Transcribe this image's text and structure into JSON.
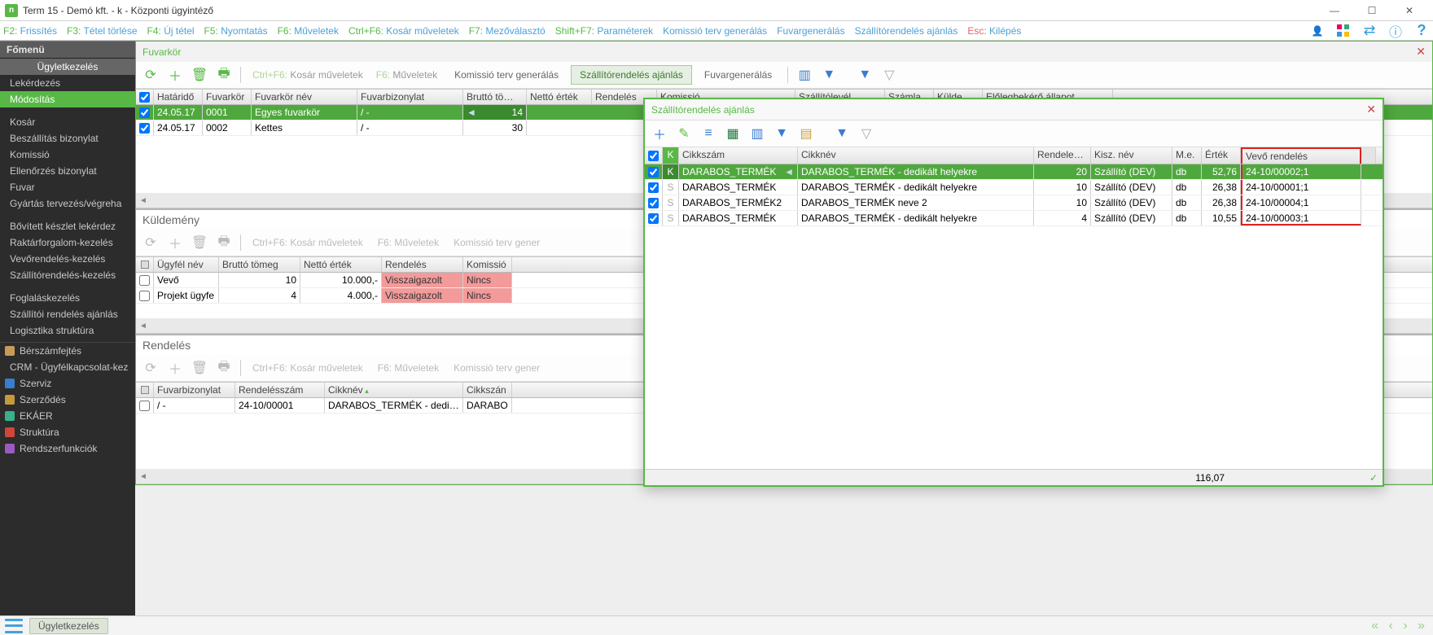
{
  "window": {
    "title": "Term 15 - Demó kft. - k - Központi ügyintéző"
  },
  "menubar": {
    "items": [
      {
        "key": "F2:",
        "label": "Frissítés"
      },
      {
        "key": "F3:",
        "label": "Tétel törlése"
      },
      {
        "key": "F4:",
        "label": "Új tétel"
      },
      {
        "key": "F5:",
        "label": "Nyomtatás"
      },
      {
        "key": "F6:",
        "label": "Műveletek"
      },
      {
        "key": "Ctrl+F6:",
        "label": "Kosár műveletek"
      },
      {
        "key": "F7:",
        "label": "Mezőválasztó"
      },
      {
        "key": "Shift+F7:",
        "label": "Paraméterek"
      },
      {
        "key": "",
        "label": "Komissió terv generálás"
      },
      {
        "key": "",
        "label": "Fuvargenerálás"
      },
      {
        "key": "",
        "label": "Szállítórendelés ajánlás"
      },
      {
        "key": "Esc:",
        "label": "Kilépés",
        "esc": true
      }
    ]
  },
  "sidebar": {
    "section": "Főmenü",
    "group": "Ügyletkezelés",
    "items_top": [
      {
        "label": "Lekérdezés"
      },
      {
        "label": "Módosítás",
        "active": true
      }
    ],
    "items_mid": [
      "Kosár",
      "Beszállítás bizonylat",
      "Komissió",
      "Ellenőrzés bizonylat",
      "Fuvar",
      "Gyártás tervezés/végreha"
    ],
    "items_low": [
      "Bővített készlet lekérdez",
      "Raktárforgalom-kezelés",
      "Vevőrendelés-kezelés",
      "Szállítórendelés-kezelés"
    ],
    "items_bottom": [
      "Foglaláskezelés",
      "Szállítói rendelés ajánlás",
      "Logisztika struktúra"
    ],
    "modules": [
      {
        "label": "Bérszámfejtés",
        "color": "#c89a5a"
      },
      {
        "label": "CRM - Ügyfélkapcsolat-kez",
        "color": "#c44"
      },
      {
        "label": "Szerviz",
        "color": "#3a7cd0"
      },
      {
        "label": "Szerződés",
        "color": "#c49a3a"
      },
      {
        "label": "EKÁER",
        "color": "#3ab08a"
      },
      {
        "label": "Struktúra",
        "color": "#d0473a"
      },
      {
        "label": "Rendszerfunkciók",
        "color": "#9a5ac0"
      }
    ]
  },
  "fuvarkor": {
    "title": "Fuvarkör",
    "toolbar_text": [
      {
        "key": "Ctrl+F6:",
        "label": "Kosár műveletek"
      },
      {
        "key": "F6:",
        "label": "Műveletek"
      },
      {
        "key": "",
        "label": "Komissió terv generálás"
      },
      {
        "key": "",
        "label": "Szállítórendelés ajánlás",
        "active": true
      },
      {
        "key": "",
        "label": "Fuvargenerálás"
      }
    ],
    "columns": [
      "Határidő",
      "Fuvarkör",
      "Fuvarkör név",
      "Fuvarbizonylat",
      "Bruttó tö…",
      "Nettó érték",
      "Rendelés",
      "Komissió",
      "Szállítólevél",
      "Számla",
      "Külde…",
      "Előlegbekérő állapot"
    ],
    "rows": [
      {
        "chk": true,
        "vals": [
          "24.05.17",
          "0001",
          "Egyes fuvarkör",
          "/  -",
          "14"
        ],
        "selected": true
      },
      {
        "chk": true,
        "vals": [
          "24.05.17",
          "0002",
          "Kettes",
          "/  -",
          "30"
        ],
        "selected": false
      }
    ]
  },
  "kuldemeny": {
    "title": "Küldemény",
    "toolbar_text": [
      {
        "key": "Ctrl+F6:",
        "label": "Kosár műveletek"
      },
      {
        "key": "F6:",
        "label": "Műveletek"
      },
      {
        "key": "",
        "label": "Komissió terv gener"
      }
    ],
    "columns": [
      "Ügyfél név",
      "Bruttó tömeg",
      "Nettó érték",
      "Rendelés",
      "Komissió"
    ],
    "rows": [
      {
        "vals": [
          "Vevő",
          "10",
          "10.000,-",
          "Visszaigazolt",
          "Nincs"
        ]
      },
      {
        "vals": [
          "Projekt  ügyfe",
          "4",
          "4.000,-",
          "Visszaigazolt",
          "Nincs"
        ]
      }
    ]
  },
  "rendeles": {
    "title": "Rendelés",
    "toolbar_text": [
      {
        "key": "Ctrl+F6:",
        "label": "Kosár műveletek"
      },
      {
        "key": "F6:",
        "label": "Műveletek"
      },
      {
        "key": "",
        "label": "Komissió terv gener"
      }
    ],
    "columns": [
      "Fuvarbizonylat",
      "Rendelésszám",
      "Cikknév",
      "Cikkszán"
    ],
    "rows": [
      {
        "vals": [
          "/  -",
          "24-10/00001",
          "DARABOS_TERMÉK - dedikált",
          "DARABO"
        ]
      }
    ]
  },
  "popup": {
    "title": "Szállítórendelés ajánlás",
    "columns": [
      "K",
      "Cikkszám",
      "Cikknév",
      "Rendelendő",
      "Kisz. név",
      "M.e.",
      "Érték",
      "Vevő rendelés"
    ],
    "rows": [
      {
        "chk": true,
        "selected": true,
        "k": "K",
        "vals": [
          "DARABOS_TERMÉK",
          "DARABOS_TERMÉK - dedikált helyekre",
          "20",
          "Szállító (DEV)",
          "db",
          "52,76",
          "24-10/00002;1"
        ]
      },
      {
        "chk": true,
        "selected": false,
        "k": "S",
        "vals": [
          "DARABOS_TERMÉK",
          "DARABOS_TERMÉK - dedikált helyekre",
          "10",
          "Szállító (DEV)",
          "db",
          "26,38",
          "24-10/00001;1"
        ]
      },
      {
        "chk": true,
        "selected": false,
        "k": "S",
        "vals": [
          "DARABOS_TERMÉK2",
          "DARABOS_TERMÉK neve 2",
          "10",
          "Szállító (DEV)",
          "db",
          "26,38",
          "24-10/00004;1"
        ]
      },
      {
        "chk": true,
        "selected": false,
        "k": "S",
        "vals": [
          "DARABOS_TERMÉK",
          "DARABOS_TERMÉK - dedikált helyekre",
          "4",
          "Szállító (DEV)",
          "db",
          "10,55",
          "24-10/00003;1"
        ]
      }
    ],
    "footer_total": "116,07"
  },
  "status": {
    "label": "Ügyletkezelés"
  }
}
